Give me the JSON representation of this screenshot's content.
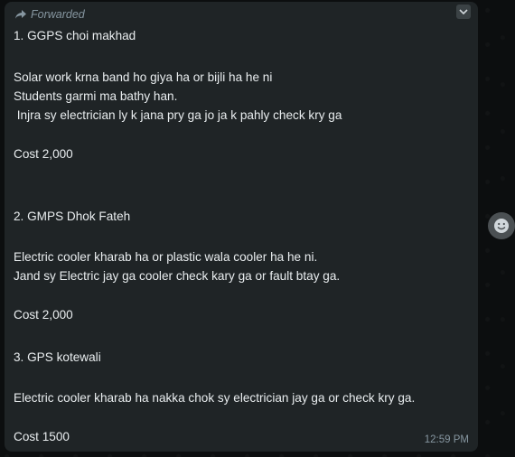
{
  "message": {
    "forwarded_label": "Forwarded",
    "lines": [
      "1. GGPS choi makhad",
      "Solar work krna band ho giya ha or bijli ha he ni",
      "Students garmi ma bathy han.",
      " Injra sy electrician ly k jana pry ga jo ja k pahly check kry ga",
      "Cost 2,000",
      "2. GMPS Dhok Fateh",
      "Electric cooler kharab ha or plastic wala cooler ha he ni.",
      "Jand sy Electric jay ga cooler check kary ga or fault btay ga.",
      "Cost 2,000",
      "3. GPS kotewali",
      "Electric cooler kharab ha nakka chok sy electrician jay ga or check kry ga.",
      "Cost 1500"
    ],
    "timestamp": "12:59 PM"
  },
  "icons": {
    "forward": "forward-arrow-icon",
    "menu": "chevron-down-icon",
    "react": "emoji-icon"
  },
  "colors": {
    "bubble": "#1f2426",
    "text": "#e9edef",
    "meta": "#8696a0"
  }
}
